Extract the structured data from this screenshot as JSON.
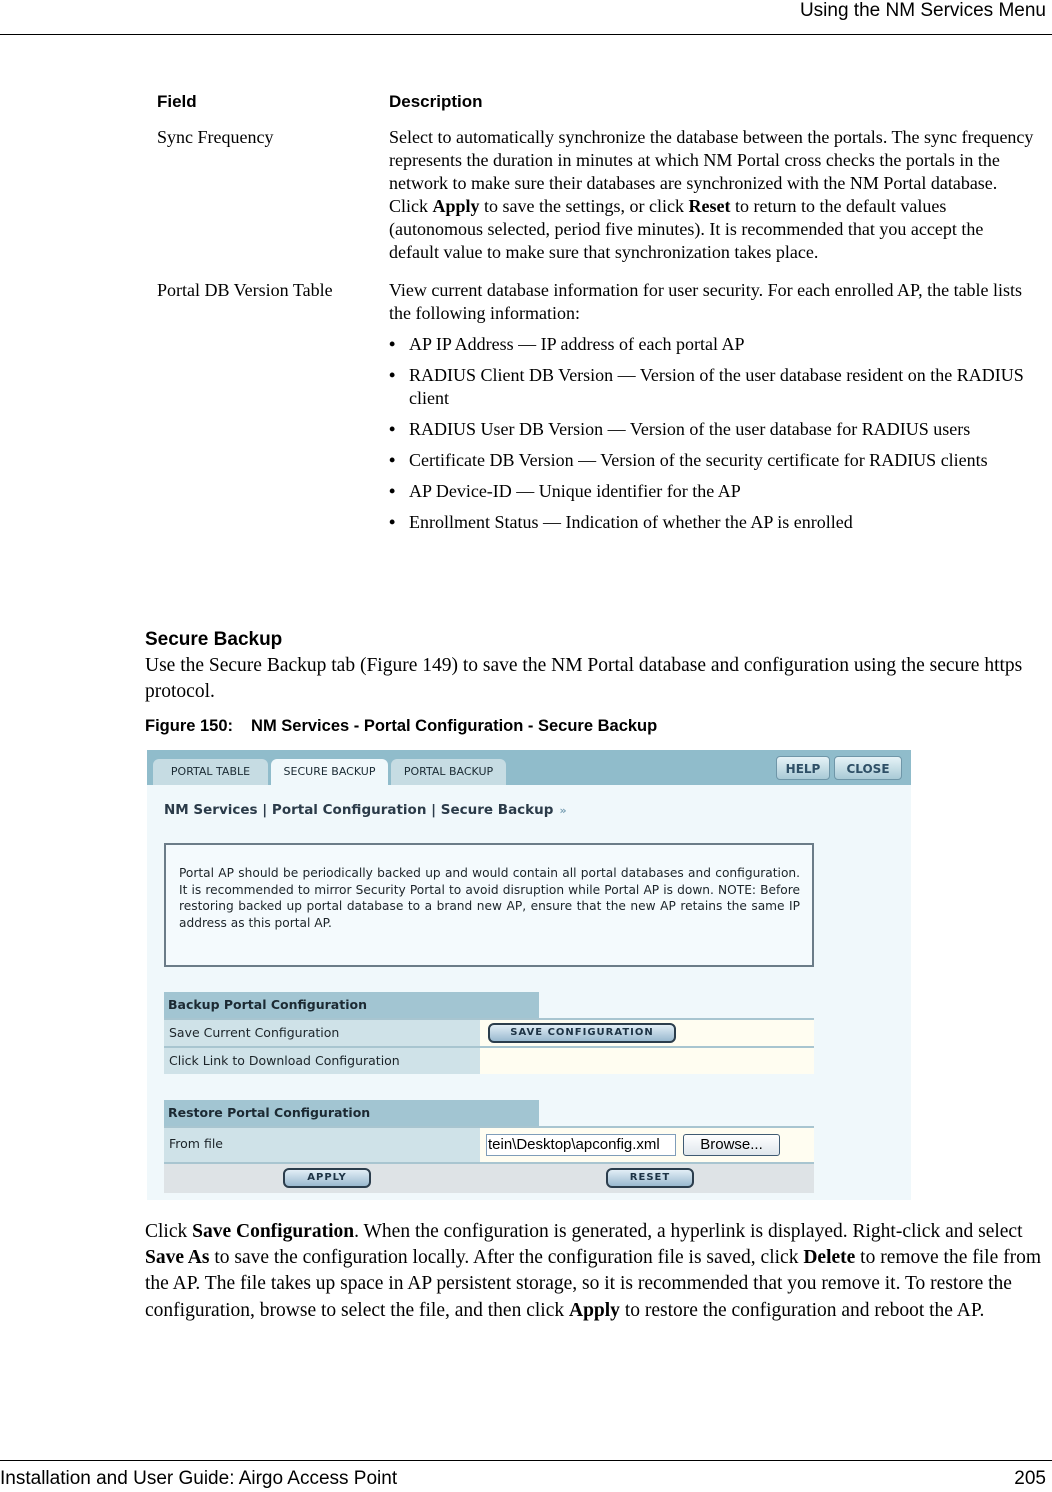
{
  "header": {
    "title": "Using the NM Services Menu"
  },
  "footer": {
    "left": "Installation and User Guide: Airgo Access Point",
    "page_number": "205"
  },
  "field_table": {
    "headers": {
      "field": "Field",
      "description": "Description"
    },
    "rows": [
      {
        "field": "Sync Frequency",
        "description_parts": [
          {
            "text": "Select to automatically synchronize the database between the portals. The sync frequency represents the duration in minutes at which NM Portal cross checks the portals in the network to make sure their databases are synchronized with the NM Portal database. Click "
          },
          {
            "text": "Apply",
            "bold": true
          },
          {
            "text": " to save the settings, or click "
          },
          {
            "text": "Reset",
            "bold": true
          },
          {
            "text": " to return to the default values (autonomous selected, period five minutes). It is recommended that you accept the default value to make sure that synchronization takes place."
          }
        ]
      },
      {
        "field": "Portal DB Version Table",
        "description": "View current database information for user security. For each enrolled AP, the table lists the following information:",
        "bullets": [
          "AP IP Address — IP address of each portal AP",
          "RADIUS Client DB Version — Version of the user database resident on the RADIUS client",
          "RADIUS User DB Version — Version of the user database for RADIUS users",
          "Certificate DB Version — Version of the security certificate for RADIUS clients",
          "AP Device-ID — Unique identifier for the AP",
          "Enrollment Status — Indication of whether the AP is enrolled"
        ]
      }
    ]
  },
  "section": {
    "heading": "Secure Backup",
    "intro": "Use the Secure Backup tab (Figure 149) to save the NM Portal database and configuration using the secure https protocol."
  },
  "figure": {
    "label": "Figure 150:",
    "caption": "NM Services - Portal Configuration - Secure Backup",
    "screenshot": {
      "tabs": [
        {
          "label": "PORTAL TABLE",
          "active": false
        },
        {
          "label": "SECURE BACKUP",
          "active": true
        },
        {
          "label": "PORTAL BACKUP",
          "active": false
        }
      ],
      "help_label": "HELP",
      "close_label": "CLOSE",
      "breadcrumb": "NM Services | Portal Configuration | Secure Backup",
      "breadcrumb_arrow": "»",
      "note": "Portal AP should be periodically backed up and would contain all portal databases and configuration. It is recommended to mirror Security Portal to avoid disruption while Portal AP is down. NOTE: Before restoring backed up portal database to a brand new AP, ensure that the new AP retains the same IP address as this portal AP.",
      "backup_section": {
        "title": "Backup Portal Configuration",
        "save_label": "Save Current Configuration",
        "save_button": "SAVE CONFIGURATION",
        "download_label": "Click Link to Download Configuration",
        "download_value": ""
      },
      "restore_section": {
        "title": "Restore Portal Configuration",
        "from_file_label": "From file",
        "file_value": "tein\\Desktop\\apconfig.xml",
        "browse_button": "Browse...",
        "apply_button": "APPLY",
        "reset_button": "RESET"
      },
      "colors": {
        "tabbar": "#90bccb",
        "panel_bg": "#f0f8fb",
        "section_header": "#a2c5d2",
        "label_cell": "#cfe2e8",
        "value_cell": "#fffdf1"
      }
    }
  },
  "after_figure": [
    {
      "text": "Click "
    },
    {
      "text": "Save Configuration",
      "bold": true
    },
    {
      "text": ". When the configuration is generated, a hyperlink is displayed. Right-click and select "
    },
    {
      "text": "Save As",
      "bold": true
    },
    {
      "text": " to save the configuration locally. After the configuration file is saved, click "
    },
    {
      "text": "Delete",
      "bold": true
    },
    {
      "text": " to remove the file from the AP. The file takes up space in AP persistent storage, so it is recommended that you remove it. To restore the configuration, browse to select the file, and then click "
    },
    {
      "text": "Apply",
      "bold": true
    },
    {
      "text": " to restore the configuration and reboot the AP."
    }
  ]
}
